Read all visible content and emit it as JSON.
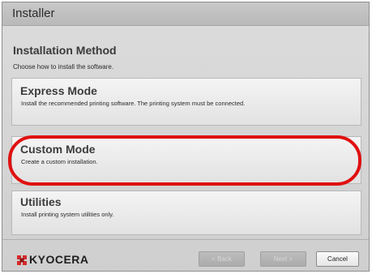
{
  "window": {
    "title": "Installer"
  },
  "page": {
    "heading": "Installation Method",
    "subtext": "Choose how to install the software."
  },
  "options": [
    {
      "title": "Express Mode",
      "description": "Install the recommended printing software. The printing system must be connected."
    },
    {
      "title": "Custom Mode",
      "description": "Create a custom installation."
    },
    {
      "title": "Utilities",
      "description": "Install printing system utilities only."
    }
  ],
  "footer": {
    "logo_text": "KYOCERA",
    "back_label": "< Back",
    "next_label": "Next >",
    "cancel_label": "Cancel"
  },
  "colors": {
    "highlight": "#e01010",
    "logo_mark": "#d42a2a"
  }
}
